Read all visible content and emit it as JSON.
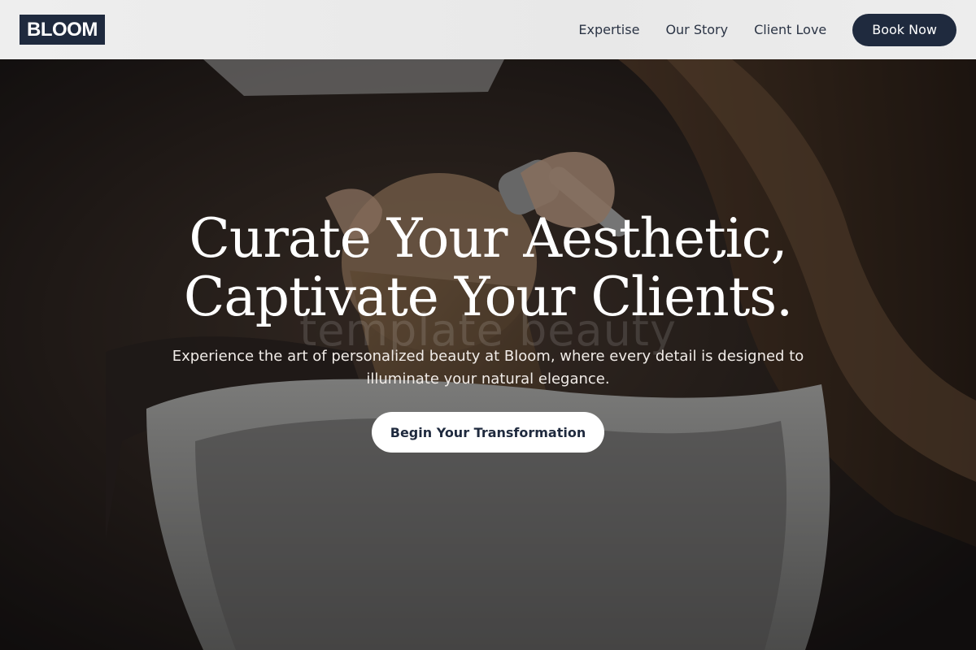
{
  "header": {
    "logo": "BLOOM",
    "nav": [
      {
        "label": "Expertise"
      },
      {
        "label": "Our Story"
      },
      {
        "label": "Client Love"
      }
    ],
    "cta_label": "Book Now"
  },
  "hero": {
    "title_line1": "Curate Your Aesthetic,",
    "title_line2": "Captivate Your Clients.",
    "watermark": "template beauty",
    "subtitle": "Experience the art of personalized beauty at Bloom, where every detail is designed to illuminate your natural elegance.",
    "cta_label": "Begin Your Transformation"
  },
  "colors": {
    "brand_navy": "#1f2a3e",
    "header_bg": "#eeeeee",
    "hero_text": "#ffffff"
  }
}
